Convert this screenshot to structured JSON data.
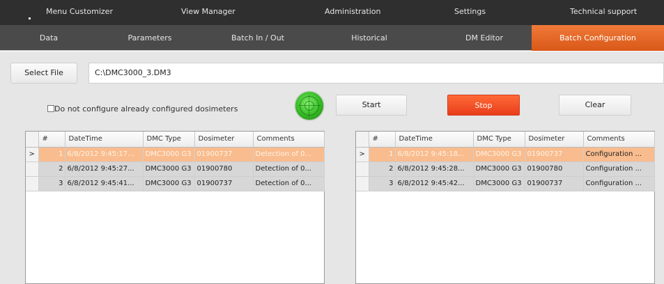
{
  "top_menu": [
    "Menu Customizer",
    "View Manager",
    "Administration",
    "Settings",
    "Technical support"
  ],
  "tabs": [
    {
      "label": "Data"
    },
    {
      "label": "Parameters"
    },
    {
      "label": "Batch In / Out"
    },
    {
      "label": "Historical"
    },
    {
      "label": "DM Editor"
    },
    {
      "label": "Batch Configuration",
      "active": true
    }
  ],
  "toolbar": {
    "select_file_label": "Select File",
    "file_path": "C:\\DMC3000_3.DM3",
    "checkbox_label": "Do not configure already configured dosimeters",
    "checkbox_checked": false,
    "start_label": "Start",
    "stop_label": "Stop",
    "clear_label": "Clear"
  },
  "columns": [
    "#",
    "DateTime",
    "DMC Type",
    "Dosimeter",
    "Comments"
  ],
  "left_table": {
    "rows": [
      {
        "num": "1",
        "datetime": "6/8/2012 9:45:17...",
        "type": "DMC3000 G3",
        "dosimeter": "01900737",
        "comments": "Detection of 0...",
        "selected": true
      },
      {
        "num": "2",
        "datetime": "6/8/2012 9:45:27...",
        "type": "DMC3000 G3",
        "dosimeter": "01900780",
        "comments": "Detection of 0..."
      },
      {
        "num": "3",
        "datetime": "6/8/2012 9:45:41...",
        "type": "DMC3000 G3",
        "dosimeter": "01900737",
        "comments": "Detection of 0..."
      }
    ]
  },
  "right_table": {
    "rows": [
      {
        "num": "1",
        "datetime": "6/8/2012 9:45:18...",
        "type": "DMC3000 G3",
        "dosimeter": "01900737",
        "comments": "Configuration ...",
        "selected": true
      },
      {
        "num": "2",
        "datetime": "6/8/2012 9:45:28...",
        "type": "DMC3000 G3",
        "dosimeter": "01900780",
        "comments": "Configuration ..."
      },
      {
        "num": "3",
        "datetime": "6/8/2012 9:45:42...",
        "type": "DMC3000 G3",
        "dosimeter": "01900737",
        "comments": "Configuration ..."
      }
    ]
  },
  "row_indicator": ">",
  "colors": {
    "accent": "#e8601f",
    "stop": "#f04d24",
    "selected_row": "#f9bc8e",
    "alt_row": "#d7d7d7",
    "nav_dark": "#2f2f2f",
    "nav_mid": "#4a4a4a"
  }
}
